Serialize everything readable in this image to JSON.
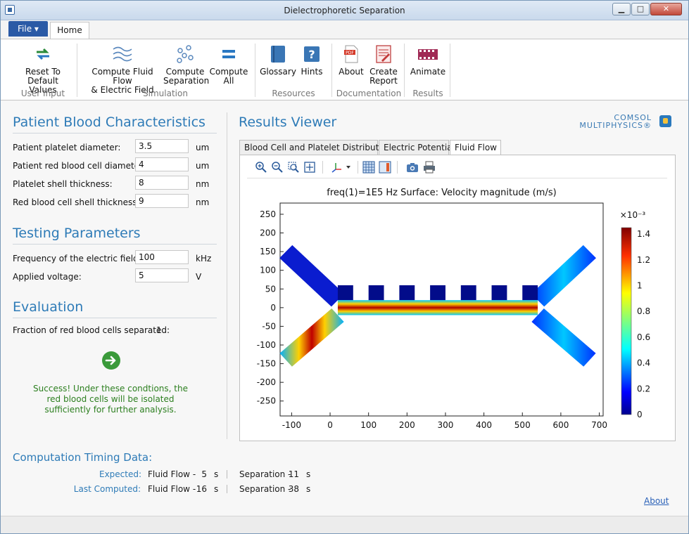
{
  "window": {
    "title": "Dielectrophoretic Separation",
    "min": "▁",
    "max": "□",
    "close": "✕"
  },
  "ribbon": {
    "file_label": "File ▾",
    "home_tab": "Home",
    "buttons": {
      "reset": "Reset To\nDefault Values",
      "compute_fluid": "Compute Fluid Flow\n& Electric Field",
      "compute_sep": "Compute\nSeparation",
      "compute_all": "Compute\nAll",
      "glossary": "Glossary",
      "hints": "Hints",
      "about": "About",
      "create_report": "Create\nReport",
      "animate": "Animate"
    },
    "groups": {
      "user_input": "User Input",
      "simulation": "Simulation",
      "resources": "Resources",
      "documentation": "Documentation",
      "results": "Results"
    }
  },
  "patient": {
    "title": "Patient Blood Characteristics",
    "fields": [
      {
        "label": "Patient platelet diameter:",
        "value": "3.5",
        "unit": "um"
      },
      {
        "label": "Patient red blood cell diameter:",
        "value": "4",
        "unit": "um"
      },
      {
        "label": "Platelet shell thickness:",
        "value": "8",
        "unit": "nm"
      },
      {
        "label": "Red blood cell shell thickness:",
        "value": "9",
        "unit": "nm"
      }
    ]
  },
  "testing": {
    "title": "Testing Parameters",
    "fields": [
      {
        "label": "Frequency of the electric field:",
        "value": "100",
        "unit": "kHz"
      },
      {
        "label": "Applied voltage:",
        "value": "5",
        "unit": "V"
      }
    ]
  },
  "evaluation": {
    "title": "Evaluation",
    "fraction_label": "Fraction of red blood cells separated:",
    "fraction_value": "1",
    "success_message": "Success! Under these condtions, the red blood cells will be isolated sufficiently for further analysis."
  },
  "results": {
    "title": "Results Viewer",
    "logo_line1": "COMSOL",
    "logo_line2": "MULTIPHYSICS®",
    "tabs": [
      "Blood Cell and Platelet Distribution",
      "Electric Potential",
      "Fluid Flow"
    ],
    "active_tab": "Fluid Flow",
    "toolbar_icons": [
      "zoom-in-icon",
      "zoom-out-icon",
      "zoom-box-icon",
      "zoom-extents-icon",
      "axis-orientation-icon",
      "grid-icon",
      "color-legend-icon",
      "camera-icon",
      "print-icon"
    ]
  },
  "chart_data": {
    "type": "heatmap",
    "title": "freq(1)=1E5 Hz   Surface: Velocity magnitude (m/s)",
    "xlim": [
      -130,
      710
    ],
    "ylim": [
      -290,
      280
    ],
    "xticks": [
      -100,
      0,
      100,
      200,
      300,
      400,
      500,
      600,
      700
    ],
    "yticks": [
      250,
      200,
      150,
      100,
      50,
      0,
      -50,
      -100,
      -150,
      -200,
      -250
    ],
    "colorbar": {
      "label": "×10⁻³",
      "ticks": [
        1.4,
        1.2,
        1,
        0.8,
        0.6,
        0.4,
        0.2,
        0
      ],
      "range": [
        0,
        1.45
      ]
    },
    "geometry": {
      "channel": {
        "x": [
          20,
          540
        ],
        "y": [
          -20,
          20
        ]
      },
      "upper_left_branch": {
        "from": [
          -115,
          150
        ],
        "to": [
          20,
          20
        ]
      },
      "lower_left_branch": {
        "from": [
          -115,
          -140
        ],
        "to": [
          20,
          -20
        ]
      },
      "upper_right_branch": {
        "from": [
          540,
          20
        ],
        "to": [
          675,
          150
        ]
      },
      "lower_right_branch": {
        "from": [
          540,
          -20
        ],
        "to": [
          675,
          -140
        ]
      },
      "teeth_x_starts": [
        20,
        100,
        180,
        260,
        340,
        420,
        500
      ],
      "tooth_width": 40,
      "tooth_height": [
        20,
        60
      ]
    }
  },
  "timing": {
    "title": "Computation Timing Data:",
    "expected_label": "Expected:",
    "last_label": "Last Computed:",
    "fluid_label": "Fluid Flow -",
    "sep_label": "Separation -",
    "expected_fluid": "5",
    "expected_sep": "11",
    "last_fluid": "16",
    "last_sep": "38",
    "unit": "s"
  },
  "about_link": "About"
}
